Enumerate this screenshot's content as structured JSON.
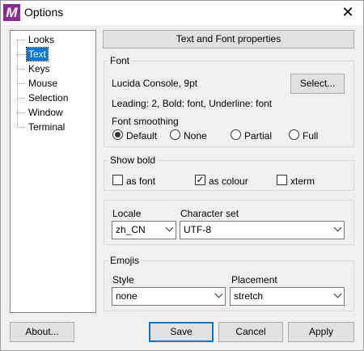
{
  "window": {
    "title": "Options",
    "app_icon_letter": "M",
    "accent": "#0078d7"
  },
  "tree": {
    "items": [
      "Looks",
      "Text",
      "Keys",
      "Mouse",
      "Selection",
      "Window",
      "Terminal"
    ],
    "selected": "Text"
  },
  "header": "Text and Font properties",
  "font": {
    "label": "Font",
    "current": "Lucida Console, 9pt",
    "select_button": "Select...",
    "details": "Leading: 2, Bold: font, Underline: font",
    "smoothing_label": "Font smoothing",
    "smoothing_options": [
      "Default",
      "None",
      "Partial",
      "Full"
    ],
    "smoothing_selected": "Default"
  },
  "show_bold": {
    "label": "Show bold",
    "options": [
      {
        "label": "as font",
        "checked": false
      },
      {
        "label": "as colour",
        "checked": true
      },
      {
        "label": "xterm",
        "checked": false
      }
    ]
  },
  "locale": {
    "label": "Locale",
    "value": "zh_CN",
    "charset_label": "Character set",
    "charset_value": "UTF-8"
  },
  "emojis": {
    "label": "Emojis",
    "style_label": "Style",
    "style_value": "none",
    "placement_label": "Placement",
    "placement_value": "stretch"
  },
  "buttons": {
    "about": "About...",
    "save": "Save",
    "cancel": "Cancel",
    "apply": "Apply"
  }
}
